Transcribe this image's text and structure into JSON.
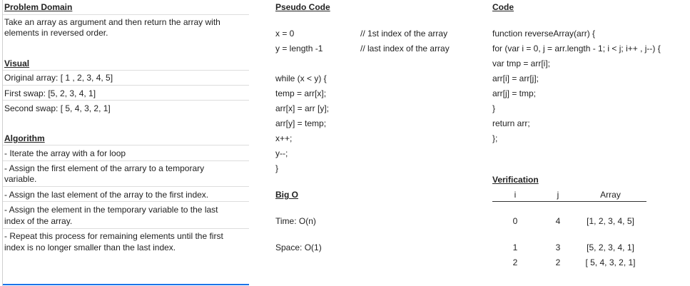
{
  "problem": {
    "heading": "Problem Domain",
    "lines": [
      "Take an array as argument and then return the array with",
      "elements in reversed order."
    ]
  },
  "visual": {
    "heading": "Visual",
    "lines": [
      "Original array: [ 1 , 2, 3, 4, 5]",
      "First swap: [5, 2, 3, 4, 1]",
      "Second swap: [ 5, 4, 3, 2, 1]"
    ]
  },
  "algorithm": {
    "heading": "Algorithm",
    "steps": [
      [
        "- Iterate the array with a for loop"
      ],
      [
        "- Assign the first element of the arrary to a temporary",
        "variable."
      ],
      [
        "- Assign the last element of the array to the first index."
      ],
      [
        "- Assign the element in the temporary variable to the last",
        "index of the array."
      ],
      [
        "- Repeat this process for remaining elements until the first",
        "index is no longer smaller than the last index."
      ]
    ]
  },
  "pseudo": {
    "heading": "Pseudo Code",
    "lines": [
      "x = 0",
      "y = length -1",
      "while (x < y) {",
      "temp = arr[x];",
      "arr[x] = arr [y];",
      "arr[y] = temp;",
      "x++;",
      "y--;",
      "}"
    ],
    "comments": [
      "// 1st index of the array",
      "// last index of the array"
    ]
  },
  "bigo": {
    "heading": "Big O",
    "time": "Time: O(n)",
    "space": "Space: O(1)"
  },
  "code": {
    "heading": "Code",
    "lines": [
      "function reverseArray(arr) {",
      "for (var i = 0, j = arr.length - 1; i < j; i++ , j--) {",
      "var tmp = arr[i];",
      "arr[i] = arr[j];",
      "arr[j] = tmp;",
      "}",
      "return arr;",
      "};"
    ]
  },
  "verification": {
    "heading": "Verification",
    "columns": [
      "i",
      "j",
      "Array"
    ],
    "rows": [
      [
        "0",
        "4",
        "[1, 2, 3, 4, 5]"
      ],
      [
        "1",
        "3",
        "[5, 2, 3, 4, 1]"
      ],
      [
        "2",
        "2",
        "[ 5, 4, 3, 2, 1]"
      ]
    ]
  }
}
